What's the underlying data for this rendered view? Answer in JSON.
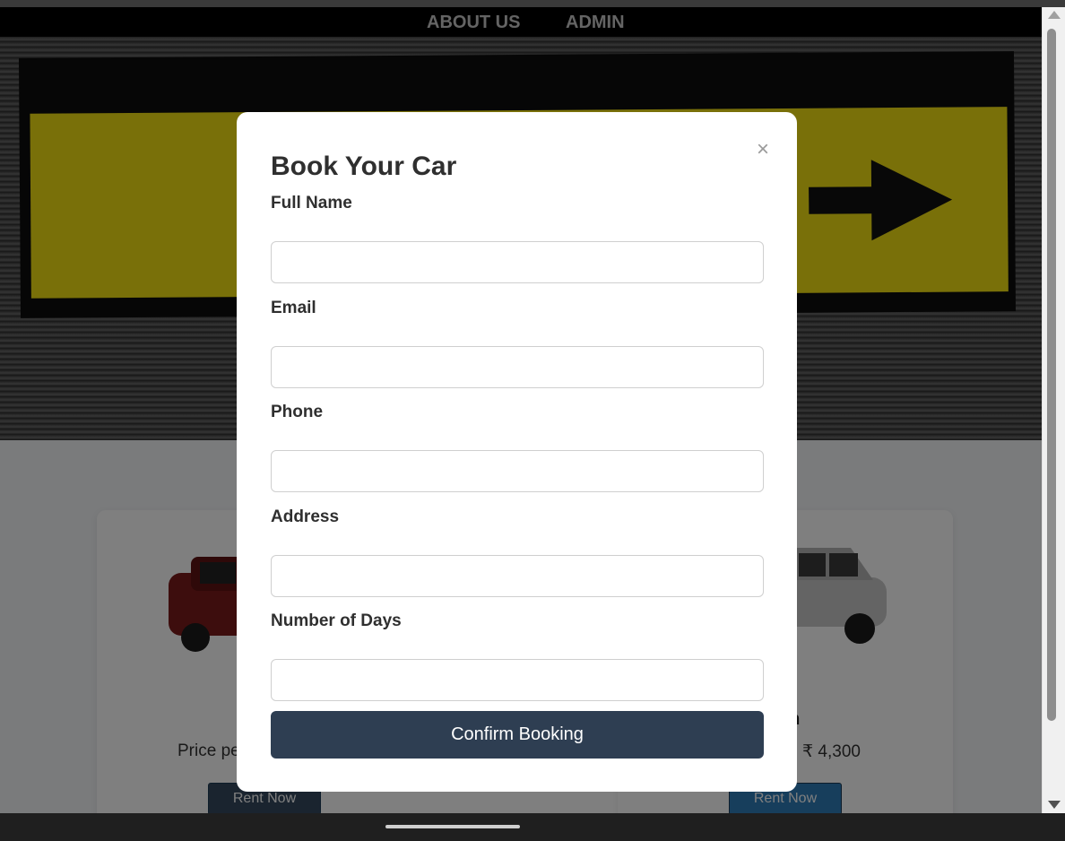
{
  "nav": {
    "about_label": "ABOUT US",
    "admin_label": "ADMIN"
  },
  "cars": [
    {
      "name": "",
      "price_text": "Price pe",
      "rent_label": "Rent Now"
    },
    {
      "name": "an",
      "price_text": "y: ₹ 4,300",
      "rent_label": "Rent Now"
    }
  ],
  "modal": {
    "title": "Book Your Car",
    "close_symbol": "×",
    "fields": [
      {
        "label": "Full Name",
        "value": "",
        "placeholder": ""
      },
      {
        "label": "Email",
        "value": "",
        "placeholder": ""
      },
      {
        "label": "Phone",
        "value": "",
        "placeholder": ""
      },
      {
        "label": "Address",
        "value": "",
        "placeholder": ""
      },
      {
        "label": "Number of Days",
        "value": "",
        "placeholder": ""
      }
    ],
    "submit_label": "Confirm Booking"
  },
  "colors": {
    "navbar_bg": "#000000",
    "nav_text": "#c8c8c8",
    "submit_bg": "#2e3e52",
    "rent_button_bg": "#2e7cb8",
    "sign_yellow": "#f2e012"
  },
  "icons": {
    "close": "close-icon",
    "hero_arrow": "arrow-right-icon",
    "scroll_up": "scroll-up-arrow-icon",
    "scroll_down": "scroll-down-arrow-icon"
  }
}
